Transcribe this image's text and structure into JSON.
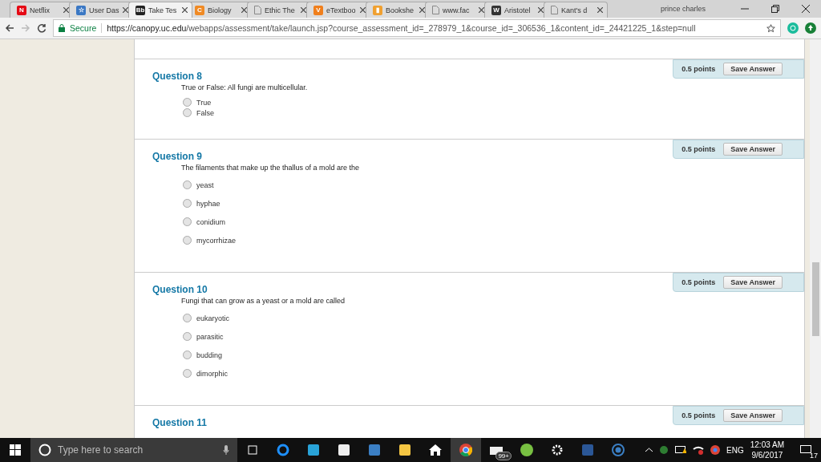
{
  "tabs": [
    {
      "label": "Netflix",
      "icon": "N",
      "color": "#e50914",
      "selected": false
    },
    {
      "label": "User Das",
      "icon": "☆",
      "color": "#3b78c4",
      "selected": false
    },
    {
      "label": "Take Tes",
      "icon": "Bb",
      "color": "#222222",
      "selected": true
    },
    {
      "label": "Biology",
      "icon": "C",
      "color": "#f08a24",
      "selected": false
    },
    {
      "label": "Ethic The",
      "color": "#888888",
      "selected": false
    },
    {
      "label": "eTextboo",
      "icon": "V",
      "color": "#f07f1c",
      "selected": false
    },
    {
      "label": "Bookshe",
      "icon": "▮",
      "color": "#f0a030",
      "selected": false
    },
    {
      "label": "www.fac",
      "color": "#888888",
      "selected": false
    },
    {
      "label": "Aristotel",
      "icon": "W",
      "color": "#333333",
      "selected": false
    },
    {
      "label": "Kant's d",
      "color": "#888888",
      "selected": false
    }
  ],
  "profile": "prince charles",
  "address": {
    "secure": "Secure",
    "host": "https://canopy.uc.edu",
    "path": "/webapps/assessment/take/launch.jsp?course_assessment_id=_278979_1&course_id=_306536_1&content_id=_24421225_1&step=null"
  },
  "questions": [
    {
      "title": "Question 8",
      "points": "0.5 points",
      "save": "Save Answer",
      "prompt": "True or False:  All fungi are multicellular.",
      "compact": true,
      "options": [
        {
          "label": "True",
          "selected": false
        },
        {
          "label": "False",
          "selected": false
        }
      ]
    },
    {
      "title": "Question 9",
      "points": "0.5 points",
      "save": "Save Answer",
      "prompt": "The filaments that make up the thallus of a mold are the",
      "compact": false,
      "options": [
        {
          "label": "yeast",
          "selected": false
        },
        {
          "label": "hyphae",
          "selected": false
        },
        {
          "label": "conidium",
          "selected": false
        },
        {
          "label": "mycorrhizae",
          "selected": false
        }
      ]
    },
    {
      "title": "Question 10",
      "points": "0.5 points",
      "save": "Save Answer",
      "prompt": "Fungi that can grow as a yeast or a mold are called",
      "compact": false,
      "options": [
        {
          "label": "eukaryotic",
          "selected": false
        },
        {
          "label": "parasitic",
          "selected": false
        },
        {
          "label": "budding",
          "selected": false
        },
        {
          "label": "dimorphic",
          "selected": false
        }
      ]
    },
    {
      "title": "Question 11",
      "points": "0.5 points",
      "save": "Save Answer",
      "compact": true
    }
  ],
  "taskbar": {
    "search": "Type here to search",
    "mail_badge": "99+",
    "language": "ENG",
    "time": "12:03 AM",
    "date": "9/6/2017",
    "notifications": "17"
  }
}
